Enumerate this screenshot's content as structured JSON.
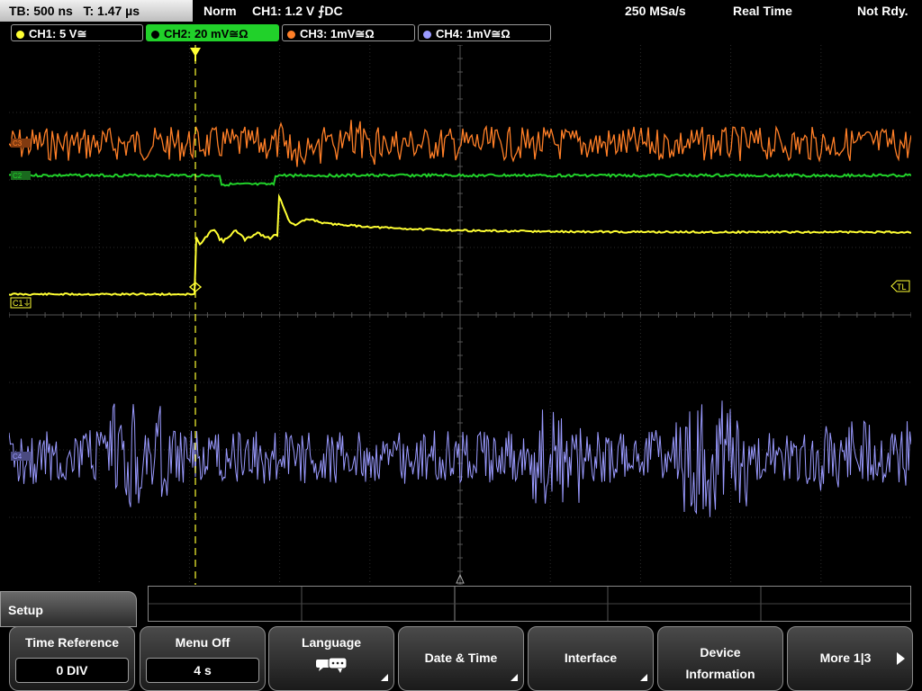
{
  "status": {
    "timebase": "TB: 500 ns",
    "trigger_time": "T: 1.47 µs",
    "mode": "Norm",
    "trigger": "CH1: 1.2 V ⨍DC",
    "sample_rate": "250 MSa/s",
    "acq_mode": "Real Time",
    "state": "Not Rdy."
  },
  "channels": [
    {
      "label": "CH1: 5 V≅",
      "color": "#ffff33"
    },
    {
      "label": "CH2: 20 mV≅Ω",
      "color": "#21d12a"
    },
    {
      "label": "CH3: 1mV≅Ω",
      "color": "#ff7f27"
    },
    {
      "label": "CH4: 1mV≅Ω",
      "color": "#9a9aff"
    }
  ],
  "markers": {
    "ch1": "C1⏚",
    "trigger_level": "TL",
    "ch2": "C2",
    "ch3": "C3",
    "ch4": "C4"
  },
  "menu": {
    "title": "Setup",
    "buttons": {
      "time_reference": {
        "label": "Time Reference",
        "value": "0 DIV"
      },
      "menu_off": {
        "label": "Menu Off",
        "value": "4 s"
      },
      "language": {
        "label": "Language"
      },
      "date_time": {
        "label": "Date & Time"
      },
      "interface": {
        "label": "Interface"
      },
      "device_info": {
        "label": "Device Information"
      },
      "more": {
        "label": "More 1|3"
      }
    }
  }
}
